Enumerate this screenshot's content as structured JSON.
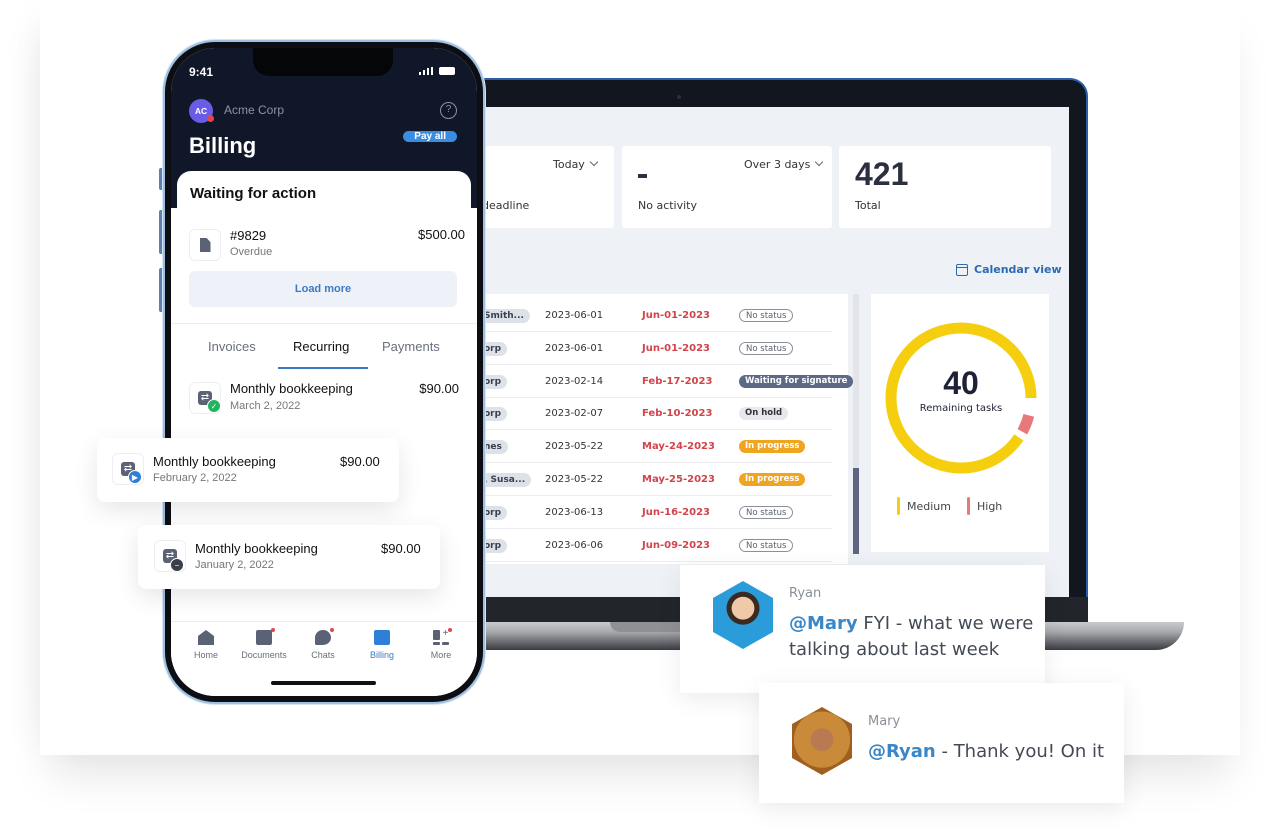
{
  "laptop": {
    "stats": [
      {
        "label": "deadline",
        "dropdown": "Today",
        "value": ""
      },
      {
        "label": "No activity",
        "dropdown": "Over 3 days",
        "value": "-"
      },
      {
        "label": "Total",
        "dropdown": "",
        "value": "421"
      }
    ],
    "calendar_view_label": "Calendar view",
    "table_rows": [
      {
        "client": "Smith...",
        "created": "2023-06-01",
        "due": "Jun-01-2023",
        "status": "No status",
        "status_type": "none"
      },
      {
        "client": "orp",
        "created": "2023-06-01",
        "due": "Jun-01-2023",
        "status": "No status",
        "status_type": "none"
      },
      {
        "client": "orp",
        "created": "2023-02-14",
        "due": "Feb-17-2023",
        "status": "Waiting for signature",
        "status_type": "waiting"
      },
      {
        "client": "orp",
        "created": "2023-02-07",
        "due": "Feb-10-2023",
        "status": "On hold",
        "status_type": "hold"
      },
      {
        "client": "nes",
        "created": "2023-05-22",
        "due": "May-24-2023",
        "status": "In progress",
        "status_type": "progress"
      },
      {
        "client": ", Susa...",
        "created": "2023-05-22",
        "due": "May-25-2023",
        "status": "In progress",
        "status_type": "progress"
      },
      {
        "client": "orp",
        "created": "2023-06-13",
        "due": "Jun-16-2023",
        "status": "No status",
        "status_type": "none"
      },
      {
        "client": "orp",
        "created": "2023-06-06",
        "due": "Jun-09-2023",
        "status": "No status",
        "status_type": "none"
      }
    ],
    "donut": {
      "value": "40",
      "label": "Remaining tasks",
      "segments": [
        {
          "name": "Medium",
          "fraction": 0.93,
          "color": "#f5cf0f"
        },
        {
          "name": "High",
          "fraction": 0.04,
          "color": "#e7797a"
        }
      ],
      "legend": [
        {
          "label": "Medium",
          "color": "#f5cf0f"
        },
        {
          "label": "High",
          "color": "#e7797a"
        }
      ]
    }
  },
  "phone": {
    "time": "9:41",
    "avatar_initials": "AC",
    "org_name": "Acme Corp",
    "help_icon": "?",
    "title": "Billing",
    "pay_all_label": "Pay all",
    "waiting": {
      "title": "Waiting for action",
      "invoice_number": "#9829",
      "invoice_status": "Overdue",
      "invoice_amount": "$500.00",
      "load_more_label": "Load more"
    },
    "tabs": [
      {
        "label": "Invoices",
        "active": false
      },
      {
        "label": "Recurring",
        "active": true
      },
      {
        "label": "Payments",
        "active": false
      }
    ],
    "recurring": [
      {
        "title": "Monthly bookkeeping",
        "date": "March 2, 2022",
        "amount": "$90.00",
        "badge": "check",
        "badge_color": "#22b35e"
      },
      {
        "title": "Monthly bookkeeping",
        "date": "February 2, 2022",
        "amount": "$90.00",
        "badge": "play",
        "badge_color": "#2d7fd8"
      },
      {
        "title": "Monthly bookkeeping",
        "date": "January 2, 2022",
        "amount": "$90.00",
        "badge": "minus",
        "badge_color": "#3b3f4a"
      }
    ],
    "nav": [
      {
        "label": "Home",
        "icon": "home-icon",
        "active": false,
        "dot": false
      },
      {
        "label": "Documents",
        "icon": "folder-icon",
        "active": false,
        "dot": true
      },
      {
        "label": "Chats",
        "icon": "chat-icon",
        "active": false,
        "dot": true
      },
      {
        "label": "Billing",
        "icon": "wallet-icon",
        "active": true,
        "dot": false
      },
      {
        "label": "More",
        "icon": "grid-plus-icon",
        "active": false,
        "dot": true
      }
    ]
  },
  "chats": [
    {
      "name": "Ryan",
      "mention": "@Mary",
      "message": " FYI - what we were talking about last week"
    },
    {
      "name": "Mary",
      "mention": "@Ryan",
      "message": " - Thank you! On it"
    }
  ]
}
